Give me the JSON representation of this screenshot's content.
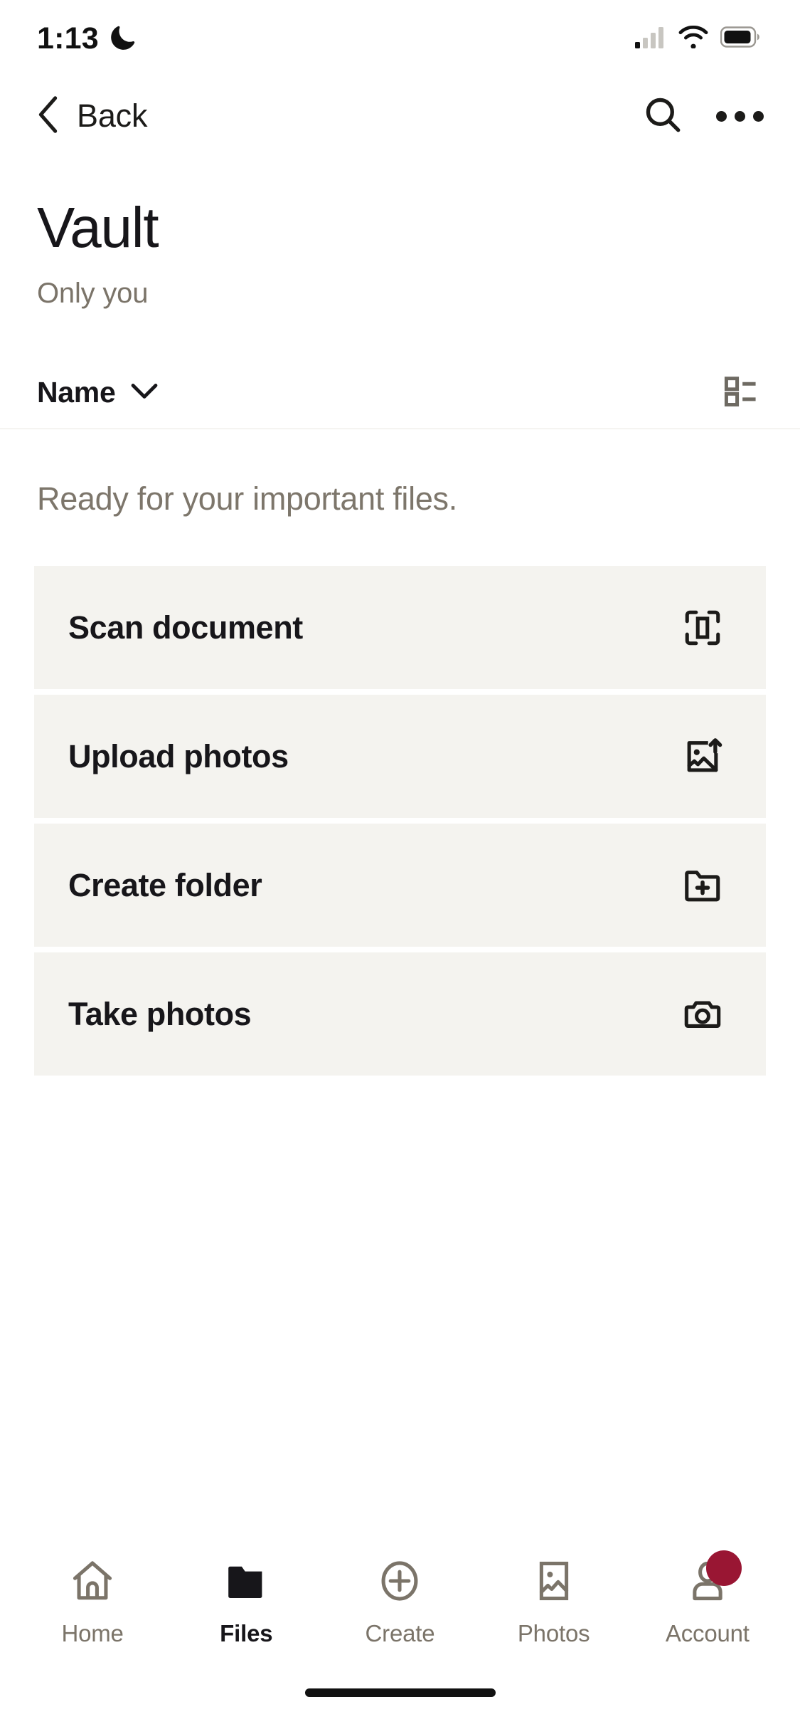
{
  "status_bar": {
    "time": "1:13",
    "dnd_icon": "crescent-moon-icon",
    "cellular_icon": "cellular-signal-icon",
    "cellular_bars_filled": 1,
    "cellular_bars_total": 4,
    "wifi_icon": "wifi-icon",
    "battery_icon": "battery-icon",
    "battery_level_percent": 85
  },
  "nav_bar": {
    "back_label": "Back",
    "back_icon": "chevron-left-icon",
    "search_icon": "search-icon",
    "overflow_icon": "more-horizontal-icon"
  },
  "header": {
    "title": "Vault",
    "subtitle": "Only you"
  },
  "sort_row": {
    "sort_label": "Name",
    "sort_chevron_icon": "chevron-down-icon",
    "view_toggle_icon": "list-view-icon"
  },
  "empty_state": {
    "message": "Ready for your important files."
  },
  "actions": [
    {
      "label": "Scan document",
      "icon": "document-scan-icon"
    },
    {
      "label": "Upload photos",
      "icon": "image-upload-icon"
    },
    {
      "label": "Create folder",
      "icon": "folder-plus-icon"
    },
    {
      "label": "Take photos",
      "icon": "camera-icon"
    }
  ],
  "tab_bar": {
    "items": [
      {
        "label": "Home",
        "icon": "home-icon",
        "active": false,
        "badge": false
      },
      {
        "label": "Files",
        "icon": "folder-icon",
        "active": true,
        "badge": false
      },
      {
        "label": "Create",
        "icon": "plus-circle-icon",
        "active": false,
        "badge": false
      },
      {
        "label": "Photos",
        "icon": "photos-icon",
        "active": false,
        "badge": false
      },
      {
        "label": "Account",
        "icon": "person-icon",
        "active": false,
        "badge": true
      }
    ]
  },
  "colors": {
    "background": "#ffffff",
    "card_background": "#f4f3ef",
    "text_primary": "#17161a",
    "text_secondary": "#7b7469",
    "badge": "#991633",
    "divider": "#e9e7e1"
  }
}
